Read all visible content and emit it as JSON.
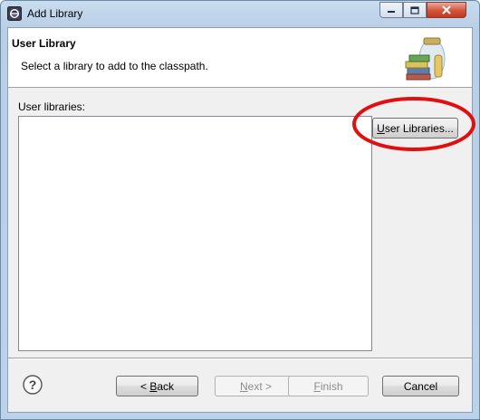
{
  "window": {
    "title": "Add Library"
  },
  "header": {
    "title": "User Library",
    "description": "Select a library to add to the classpath."
  },
  "list": {
    "label": "User libraries:",
    "items": []
  },
  "buttons": {
    "user_libraries": {
      "mnemonic": "U",
      "rest": "ser Libraries..."
    },
    "back": {
      "prefix": "< ",
      "mnemonic": "B",
      "rest": "ack"
    },
    "next": {
      "mnemonic": "N",
      "rest": "ext >"
    },
    "finish": {
      "mnemonic": "F",
      "rest": "inish"
    },
    "cancel": "Cancel"
  },
  "colors": {
    "highlight_circle": "#e01010"
  },
  "icons": [
    "eclipse-icon",
    "minimize-icon",
    "maximize-icon",
    "close-icon",
    "library-jar-icon",
    "help-icon"
  ]
}
